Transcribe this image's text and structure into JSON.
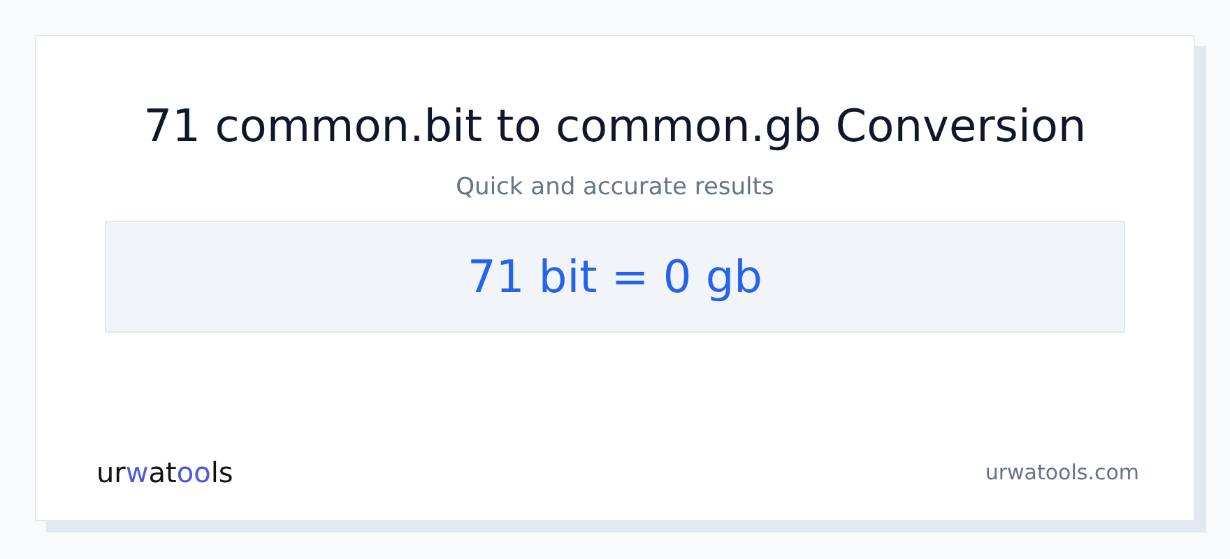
{
  "title": "71 common.bit to common.gb Conversion",
  "subtitle": "Quick and accurate results",
  "result": "71 bit = 0 gb",
  "logo": {
    "parts": [
      {
        "text": "ur",
        "accent": false
      },
      {
        "text": "w",
        "accent": true
      },
      {
        "text": "at",
        "accent": false
      },
      {
        "text": "oo",
        "accent": true
      },
      {
        "text": "ls",
        "accent": false
      }
    ]
  },
  "domain": "urwatools.com"
}
